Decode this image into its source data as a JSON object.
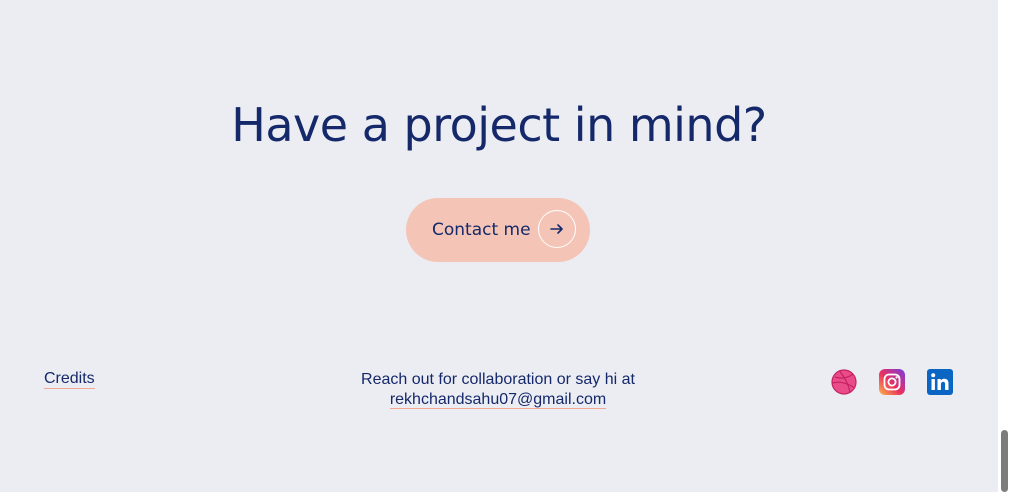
{
  "hero": {
    "headline": "Have a project in mind?",
    "contact_label": "Contact me",
    "contact_icon": "arrow-right-icon"
  },
  "footer": {
    "credits_label": "Credits",
    "reach_text": "Reach out for collaboration or say hi at",
    "email": "rekhchandsahu07@gmail.com",
    "socials": [
      {
        "name": "dribbble-icon",
        "color": "#ea4c89"
      },
      {
        "name": "instagram-icon",
        "color": "#d6249f"
      },
      {
        "name": "linkedin-icon",
        "color": "#0a66c2"
      }
    ]
  },
  "colors": {
    "panel_bg": "#ecedf3",
    "text": "#15296a",
    "button_bg": "#f4c4b6",
    "link_underline": "#f2a694"
  }
}
